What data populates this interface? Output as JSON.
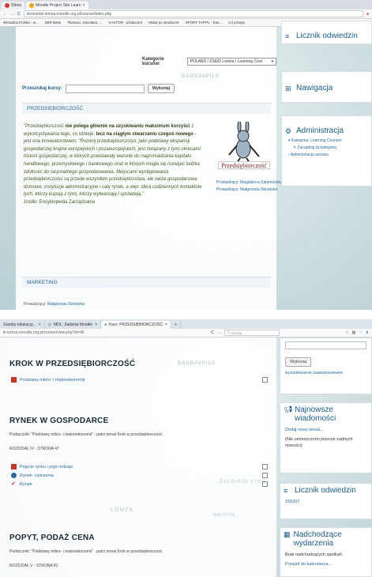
{
  "top": {
    "tabs": [
      {
        "label": "Sferia",
        "active": false
      },
      {
        "label": "Moodle Project Site Learn",
        "active": true
      }
    ],
    "url": "ekonomik-lomza.moodle.org.pl/course/index.php",
    "bookmarks": [
      "Wirtualna Polska - w...",
      "SBR Bank",
      "Tłumacz, translator, ...",
      "KASTOR - producent",
      "Układ po strukturze",
      "SPORT.TVP.PL - tran...",
      "C4 przepo"
    ],
    "category_label": "Kategorie kursów:",
    "category_value": "POLAND / ZSEiO Lomza / Learning Cour",
    "search_label": "Przeszukaj kursy:",
    "search_button": "Wykonaj",
    "course_header": "PRZEDSIĘBIORCZOŚĆ",
    "course_text": {
      "p1a": "\"Przedsiębiorczość ",
      "p1b": "nie polega głównie na uzyskiwaniu maksimum korzyści",
      "p1c": " z wykorzystywania tego, co istnieje, ",
      "p1d": "lecz na ciągłym stwarzaniu czegoś nowego",
      "p1e": " - jest ona innowatorstwem. ",
      "p1f": "\"Rozwój przedsiębiorczości, jako podstawy ekspansji gospodarczej krajów europejskich i pozaeuropejskich, jest związany z tymi okresami historii gospodarczej, w których powstawały warunki do nagromadzania kapitału handlowego, przemysłowego i bankowego oraz w których mogła się rozwijać ludzka zdolność do racjonalnego gospodarowania. Miejscami występowania przedsiębiorczości są przede wszystkim przedsiębiorstwa, ale także gospodarstwa domowe, instytucje administracyjne",
      "p1g": " i cały rynek, ",
      "p1h": "a więc sfera codziennych kontaktów tych, którzy kupują z tymi, którzy wytwarzają i sprzedają.\"",
      "source": "źródło: Encyklopedia Zarządzania"
    },
    "image_caption": "Przedsiębiorczość",
    "teachers": [
      {
        "label": "Prowadzący:",
        "name": "Magdalena Salamońska"
      },
      {
        "label": "Prowadzący:",
        "name": "Małgorzata Skrodzka"
      }
    ],
    "marketing_header": "MARKETING",
    "marketing_teacher_label": "Prowadzący:",
    "marketing_teacher_name": "Małgorzata Skrodzka",
    "map_labels": [
      "DAUGAVPILS"
    ],
    "side_blocks": {
      "counter_title": "Licznik odwiedzin",
      "nav_title": "Nawigacja",
      "admin_title": "Administracja",
      "admin_items": [
        "Kategoria: Learning Courses",
        "Zarządzaj tą kategorią",
        "Administracja serwisu"
      ]
    }
  },
  "bottom": {
    "tabs": [
      {
        "label": "Zasoby edukacyj...",
        "active": false
      },
      {
        "label": "MDL: Zadania Moodle",
        "active": false
      },
      {
        "label": "Kurs: PRZEDSIĘBIORCZOŚĆ",
        "active": true
      }
    ],
    "url": "lk-lomza.moodle.org.pl/course/view.php?id=46",
    "search_placeholder": "Szukaj",
    "sections": [
      {
        "title": "KROK W PRZEDSIĘBIORCZOŚĆ",
        "activities": [
          "Podstawy mikro- i makroekonomii"
        ]
      },
      {
        "title": "RYNEK W GOSPODARCE",
        "note": "Podręcznik: \"Podstawy  mikro- i makroekonomii\" - patrz temat Krok w przedsiębiorczość",
        "chapter": "ROZDZIAŁ IV - STRONA 47",
        "activities": [
          "Pojęcie rynku i jego rodzaje",
          "Rynek- ćwiczenia",
          "Rynek"
        ]
      },
      {
        "title": "POPYT, PODAŻ CENA",
        "note": "Podręcznik: \"Podstawy  mikro- i makroekonomii\" - patrz temat Krok w przedsiębiorczość",
        "chapter": "ROZDZIAŁ V - STRONA 81"
      }
    ],
    "map_labels": [
      "DAUGAVPILS",
      "ŁOMŻA",
      "BIAŁYSTOK",
      "ŻALGIRIO VYKS"
    ],
    "side": {
      "search_button": "Wykonaj",
      "advanced_search": "wyszukiwanie zaawansowane",
      "news_title": "Najnowsze wiadomości",
      "news_add": "Dodaj nowy temat...",
      "news_empty": "(Nie umieszczono jeszcze żadnych nowości)",
      "counter_title": "Licznik odwiedzin",
      "counter_value": "155307",
      "events_title": "Nadchodzące wydarzenia",
      "events_empty": "Brak nadchodzących spotkań",
      "events_link": "Przejdź do kalendarza..."
    }
  }
}
